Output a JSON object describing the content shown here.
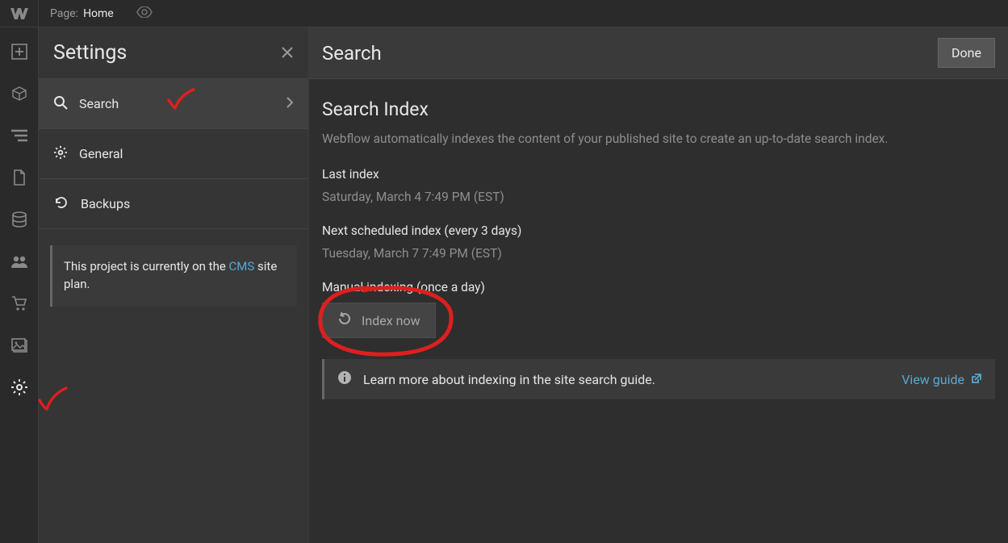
{
  "topbar": {
    "page_label": "Page:",
    "page_name": "Home"
  },
  "sidepanel": {
    "title": "Settings",
    "items": [
      {
        "label": "Search"
      },
      {
        "label": "General"
      },
      {
        "label": "Backups"
      }
    ],
    "plan_text_prefix": "This project is currently on the ",
    "plan_link": "CMS",
    "plan_text_suffix": " site plan."
  },
  "main": {
    "title": "Search",
    "done": "Done",
    "section_title": "Search Index",
    "desc": "Webflow automatically indexes the content of your published site to create an up-to-date search index.",
    "last_index_label": "Last index",
    "last_index_value": "Saturday, March 4 7:49 PM (EST)",
    "next_index_label": "Next scheduled index (every 3 days)",
    "next_index_value": "Tuesday, March 7 7:49 PM (EST)",
    "manual_label": "Manual indexing (once a day)",
    "index_now": "Index now",
    "guide_text": "Learn more about indexing in the site search guide.",
    "guide_link": "View guide"
  }
}
